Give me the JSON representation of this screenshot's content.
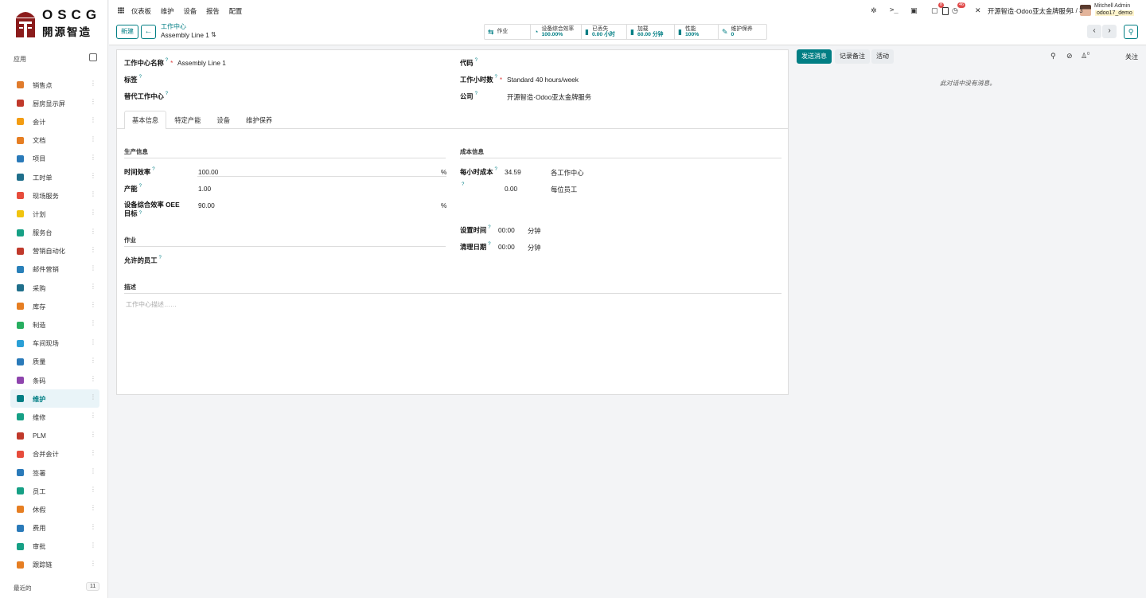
{
  "brand": {
    "name_en": "OSCG",
    "name_cn": "開源智造"
  },
  "sidebar": {
    "apps_title": "应用",
    "recent_label": "最近的",
    "recent_count": "11",
    "items": [
      {
        "label": "销售点",
        "color": "#e07b2c"
      },
      {
        "label": "厨房显示屏",
        "color": "#c0392b"
      },
      {
        "label": "会计",
        "color": "#f39c12"
      },
      {
        "label": "文档",
        "color": "#e67e22"
      },
      {
        "label": "项目",
        "color": "#2a7ab9"
      },
      {
        "label": "工时单",
        "color": "#1f6f8b"
      },
      {
        "label": "现场服务",
        "color": "#e74c3c"
      },
      {
        "label": "计划",
        "color": "#f1c40f"
      },
      {
        "label": "服务台",
        "color": "#16a085"
      },
      {
        "label": "营销自动化",
        "color": "#c0392b"
      },
      {
        "label": "邮件营销",
        "color": "#2980b9"
      },
      {
        "label": "采购",
        "color": "#1f6f8b"
      },
      {
        "label": "库存",
        "color": "#e67e22"
      },
      {
        "label": "制造",
        "color": "#27ae60"
      },
      {
        "label": "车间现场",
        "color": "#2a9fd6"
      },
      {
        "label": "质量",
        "color": "#2a7ab9"
      },
      {
        "label": "条码",
        "color": "#8e44ad"
      },
      {
        "label": "维护",
        "color": "#017e84",
        "active": true
      },
      {
        "label": "维修",
        "color": "#16a085"
      },
      {
        "label": "PLM",
        "color": "#c0392b"
      },
      {
        "label": "合并会计",
        "color": "#e74c3c"
      },
      {
        "label": "签署",
        "color": "#2a7ab9"
      },
      {
        "label": "员工",
        "color": "#16a085"
      },
      {
        "label": "休假",
        "color": "#e67e22"
      },
      {
        "label": "费用",
        "color": "#2a7ab9"
      },
      {
        "label": "审批",
        "color": "#16a085"
      },
      {
        "label": "跟踪链",
        "color": "#e67e22"
      }
    ]
  },
  "topnav": {
    "menu": [
      "仪表板",
      "维护",
      "设备",
      "报告",
      "配置"
    ],
    "messages_badge": "8",
    "activities_badge": "46",
    "company": "开源智造·Odoo亚太金牌服务",
    "user_name": "Mitchell Admin",
    "db_name": "odoo17_demo"
  },
  "control_panel": {
    "new_label": "新建",
    "breadcrumb_parent": "工作中心",
    "breadcrumb_current": "Assembly Line 1",
    "pager": "1 / 3",
    "smart_buttons": [
      {
        "icon": "work-icon",
        "glyph": "⇆",
        "title": "作业",
        "value": ""
      },
      {
        "icon": "pie-icon",
        "glyph": "◔",
        "title": "设备综合效率",
        "value": "100.00%"
      },
      {
        "icon": "bar-icon",
        "glyph": "▮",
        "title": "已丢失",
        "value": "0.00 小时"
      },
      {
        "icon": "bar-icon",
        "glyph": "▮",
        "title": "加载",
        "value": "60.00 分钟"
      },
      {
        "icon": "bar-icon",
        "glyph": "▮",
        "title": "性能",
        "value": "100%"
      },
      {
        "icon": "wrench-icon",
        "glyph": "✎",
        "title": "维护保养",
        "value": "0"
      }
    ]
  },
  "form": {
    "name_label": "工作中心名称",
    "name_value": "Assembly Line 1",
    "tags_label": "标签",
    "alt_label": "替代工作中心",
    "code_label": "代码",
    "hours_label": "工作小时数",
    "hours_value": "Standard 40 hours/week",
    "company_label": "公司",
    "company_value": "开源智造·Odoo亚太金牌服务",
    "tabs": [
      "基本信息",
      "特定产能",
      "设备",
      "维护保养"
    ],
    "prod_section": "生产信息",
    "time_eff_label": "时间效率",
    "time_eff_value": "100.00",
    "pct": "%",
    "capacity_label": "产能",
    "capacity_value": "1.00",
    "oee_label": "设备综合效率 OEE 目标",
    "oee_value": "90.00",
    "ops_section": "作业",
    "employees_label": "允许的员工",
    "cost_section": "成本信息",
    "cost_label": "每小时成本",
    "cost_value": "34.59",
    "cost_unit": "各工作中心",
    "emp_cost_value": "0.00",
    "emp_cost_unit": "每位员工",
    "setup_label": "设置时间",
    "setup_value": "00:00",
    "minutes": "分钟",
    "cleanup_label": "清理日期",
    "cleanup_value": "00:00",
    "desc_section": "描述",
    "desc_placeholder": "工作中心描述……"
  },
  "chatter": {
    "send": "发送消息",
    "note": "记录备注",
    "activity": "活动",
    "followers_count": "0",
    "follow": "关注",
    "empty": "此对话中没有消息。"
  }
}
